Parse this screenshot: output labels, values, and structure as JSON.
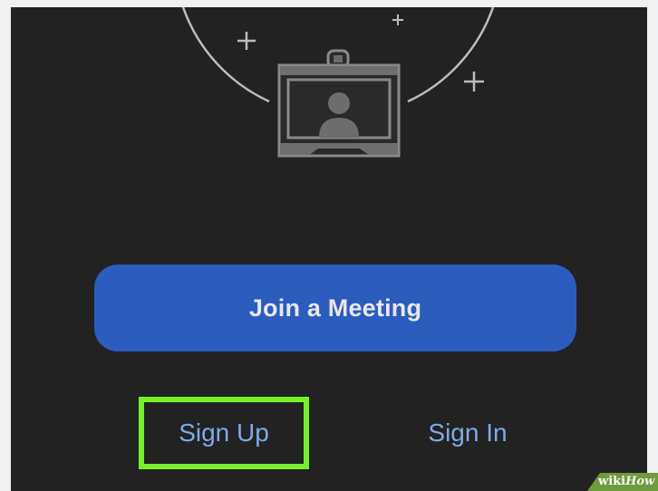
{
  "screen": {
    "join_meeting_label": "Join a Meeting",
    "sign_up_label": "Sign Up",
    "sign_in_label": "Sign In"
  },
  "watermark": {
    "prefix": "wiki",
    "suffix": "How"
  },
  "colors": {
    "background": "#222222",
    "primary_button": "#2d5cbf",
    "link_text": "#7faae6",
    "highlight": "#76f02b"
  },
  "icons": [
    "camera-illustration-icon",
    "sparkle-plus-icon"
  ]
}
